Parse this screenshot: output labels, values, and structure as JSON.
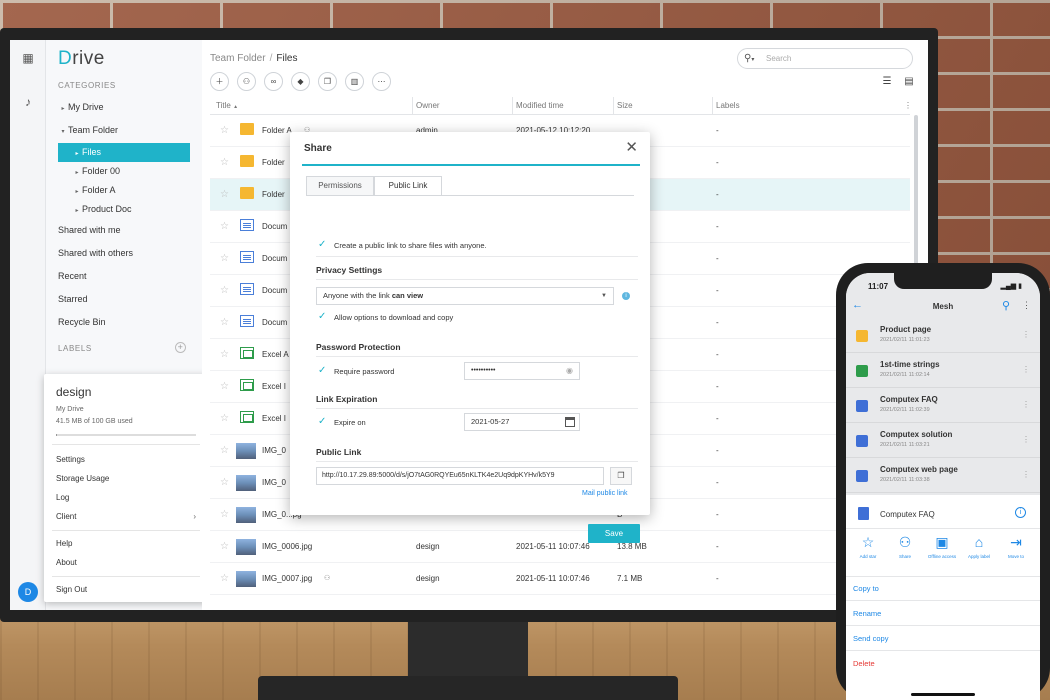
{
  "app": {
    "logo_initial": "D",
    "logo_rest": "rive"
  },
  "sidebar": {
    "categories_label": "CATEGORIES",
    "items": [
      {
        "label": "My Drive",
        "caret": "▸"
      },
      {
        "label": "Team Folder",
        "caret": "▾"
      },
      {
        "label": "Files",
        "caret": "▸"
      },
      {
        "label": "Folder 00",
        "caret": "▸"
      },
      {
        "label": "Folder A",
        "caret": "▸"
      },
      {
        "label": "Product Doc",
        "caret": "▸"
      },
      {
        "label": "Shared with me",
        "caret": ""
      },
      {
        "label": "Shared with others",
        "caret": ""
      },
      {
        "label": "Recent",
        "caret": ""
      },
      {
        "label": "Starred",
        "caret": ""
      },
      {
        "label": "Recycle Bin",
        "caret": ""
      }
    ],
    "labels_label": "LABELS",
    "labels_add": "+"
  },
  "user_popover": {
    "name": "design",
    "drive": "My Drive",
    "usage": "41.5 MB of 100 GB used",
    "usage_fraction": 0.0004,
    "menu": [
      "Settings",
      "Storage Usage",
      "Log",
      "Client",
      "Help",
      "About",
      "Sign Out"
    ],
    "client_chevron": "›",
    "avatar_letter": "D"
  },
  "header": {
    "crumb_parent": "Team Folder",
    "crumb_sep": "/",
    "crumb_current": "Files",
    "search_placeholder": "Search",
    "search_caret": "▾"
  },
  "table": {
    "headers": {
      "title": "Title",
      "sort": "▲",
      "owner": "Owner",
      "modified": "Modified time",
      "size": "Size",
      "labels": "Labels",
      "menu": "⋮"
    },
    "rows": [
      {
        "name": "Folder A",
        "owner": "admin",
        "modified": "2021-05-12 10:12:20",
        "size": "",
        "label": "-",
        "type": "folder",
        "shared": true
      },
      {
        "name": "Folder",
        "owner": "",
        "modified": "",
        "size": "",
        "label": "-",
        "type": "folder",
        "shared": false
      },
      {
        "name": "Folder",
        "owner": "",
        "modified": "",
        "size": "",
        "label": "-",
        "type": "folder",
        "shared": false
      },
      {
        "name": "Docum",
        "owner": "",
        "modified": "",
        "size": "3",
        "label": "-",
        "type": "doc",
        "shared": false
      },
      {
        "name": "Docum",
        "owner": "",
        "modified": "",
        "size": "3",
        "label": "-",
        "type": "doc",
        "shared": false
      },
      {
        "name": "Docum",
        "owner": "",
        "modified": "",
        "size": "3",
        "label": "-",
        "type": "doc",
        "shared": false
      },
      {
        "name": "Docum",
        "owner": "",
        "modified": "",
        "size": "3",
        "label": "-",
        "type": "doc",
        "shared": false
      },
      {
        "name": "Excel A",
        "owner": "",
        "modified": "",
        "size": "",
        "label": "-",
        "type": "sheet",
        "shared": false
      },
      {
        "name": "Excel I",
        "owner": "",
        "modified": "",
        "size": "",
        "label": "-",
        "type": "sheet",
        "shared": false
      },
      {
        "name": "Excel I",
        "owner": "",
        "modified": "",
        "size": "",
        "label": "-",
        "type": "sheet",
        "shared": false
      },
      {
        "name": "IMG_0",
        "owner": "",
        "modified": "",
        "size": "B",
        "label": "-",
        "type": "img",
        "shared": false
      },
      {
        "name": "IMG_0",
        "owner": "",
        "modified": "",
        "size": "B",
        "label": "-",
        "type": "img",
        "shared": false
      },
      {
        "name": "IMG_0...pg",
        "owner": "",
        "modified": "",
        "size": "B",
        "label": "-",
        "type": "img",
        "shared": false
      },
      {
        "name": "IMG_0006.jpg",
        "owner": "design",
        "modified": "2021-05-11 10:07:46",
        "size": "13.8 MB",
        "label": "-",
        "type": "img",
        "shared": false
      },
      {
        "name": "IMG_0007.jpg",
        "owner": "design",
        "modified": "2021-05-11 10:07:46",
        "size": "7.1 MB",
        "label": "-",
        "type": "img",
        "shared": true
      }
    ]
  },
  "share_dialog": {
    "title": "Share",
    "close": "✕",
    "tabs": [
      "Permissions",
      "Public Link"
    ],
    "create_link_text": "Create a public link to share files with anyone.",
    "privacy_heading": "Privacy Settings",
    "privacy_prefix": "Anyone with the link",
    "privacy_suffix": "can view",
    "allow_download_text": "Allow options to download and copy",
    "password_heading": "Password Protection",
    "require_password_text": "Require password",
    "password_value": "••••••••••",
    "expiration_heading": "Link Expiration",
    "expire_on_text": "Expire on",
    "expire_date": "2021-05-27",
    "public_link_heading": "Public Link",
    "public_link_value": "http://10.17.29.89:5000/d/s/jO7tAG0RQYEu65nKLTK4e2Uq9dpKYHv/k5Y9",
    "mail_link": "Mail public link",
    "save_label": "Save",
    "check": "✓"
  },
  "phone": {
    "time": "11:07",
    "status": "▂▄▆ ▮",
    "title": "Mesh",
    "items": [
      {
        "name": "Product page",
        "date": "2021/02/11 11:01:23",
        "color": "#f5b731"
      },
      {
        "name": "1st-time strings",
        "date": "2021/02/11 11:02:14",
        "color": "#2e9c4b"
      },
      {
        "name": "Computex FAQ",
        "date": "2021/02/11 11:02:39",
        "color": "#3f6fd6"
      },
      {
        "name": "Computex solution",
        "date": "2021/02/11 11:03:21",
        "color": "#3f6fd6"
      },
      {
        "name": "Computex web page",
        "date": "2021/02/11 11:03:38",
        "color": "#3f6fd6"
      }
    ],
    "sheet_title": "Computex FAQ",
    "actions": [
      {
        "icon": "☆",
        "label": "Add star"
      },
      {
        "icon": "⚇",
        "label": "Share"
      },
      {
        "icon": "▣",
        "label": "Offline access"
      },
      {
        "icon": "⌂",
        "label": "Apply label"
      },
      {
        "icon": "⇥",
        "label": "Move to"
      }
    ],
    "menu": [
      {
        "label": "Copy to"
      },
      {
        "label": "Rename"
      },
      {
        "label": "Send copy"
      },
      {
        "label": "Delete"
      }
    ]
  },
  "colors": {
    "accent": "#1fb3c9",
    "link": "#1e88e5",
    "danger": "#e53935"
  }
}
